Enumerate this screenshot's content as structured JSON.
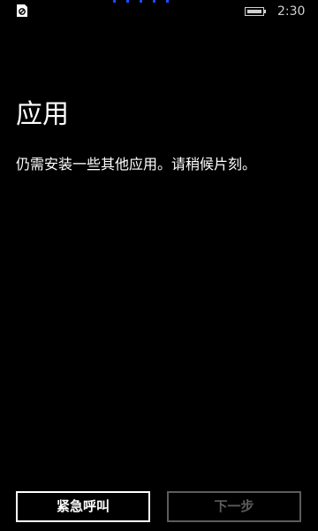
{
  "status_bar": {
    "sim_icon": "no-sim-icon",
    "battery_icon": "battery-icon",
    "battery_level": 1.0,
    "time": "2:30"
  },
  "page": {
    "title": "应用",
    "message": "仍需安装一些其他应用。请稍候片刻。"
  },
  "buttons": {
    "emergency_call": "紧急呼叫",
    "next": "下一步",
    "next_enabled": false
  },
  "colors": {
    "background": "#000000",
    "text": "#ffffff",
    "disabled": "#5c5c5c",
    "accent": "#1a4dff",
    "status": "#d0d0d0"
  }
}
